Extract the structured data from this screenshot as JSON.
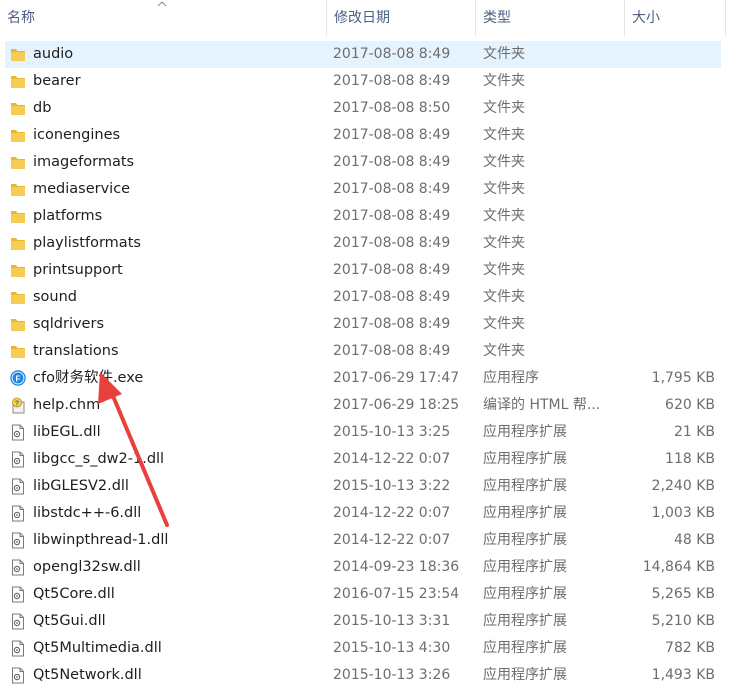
{
  "columns": {
    "name": "名称",
    "date": "修改日期",
    "type": "类型",
    "size": "大小"
  },
  "files": [
    {
      "name": "audio",
      "date": "2017-08-08 8:49",
      "type": "文件夹",
      "size": "",
      "icon": "folder-icon",
      "selected": true
    },
    {
      "name": "bearer",
      "date": "2017-08-08 8:49",
      "type": "文件夹",
      "size": "",
      "icon": "folder-icon"
    },
    {
      "name": "db",
      "date": "2017-08-08 8:50",
      "type": "文件夹",
      "size": "",
      "icon": "folder-icon"
    },
    {
      "name": "iconengines",
      "date": "2017-08-08 8:49",
      "type": "文件夹",
      "size": "",
      "icon": "folder-icon"
    },
    {
      "name": "imageformats",
      "date": "2017-08-08 8:49",
      "type": "文件夹",
      "size": "",
      "icon": "folder-icon"
    },
    {
      "name": "mediaservice",
      "date": "2017-08-08 8:49",
      "type": "文件夹",
      "size": "",
      "icon": "folder-icon"
    },
    {
      "name": "platforms",
      "date": "2017-08-08 8:49",
      "type": "文件夹",
      "size": "",
      "icon": "folder-icon"
    },
    {
      "name": "playlistformats",
      "date": "2017-08-08 8:49",
      "type": "文件夹",
      "size": "",
      "icon": "folder-icon"
    },
    {
      "name": "printsupport",
      "date": "2017-08-08 8:49",
      "type": "文件夹",
      "size": "",
      "icon": "folder-icon"
    },
    {
      "name": "sound",
      "date": "2017-08-08 8:49",
      "type": "文件夹",
      "size": "",
      "icon": "folder-icon"
    },
    {
      "name": "sqldrivers",
      "date": "2017-08-08 8:49",
      "type": "文件夹",
      "size": "",
      "icon": "folder-icon"
    },
    {
      "name": "translations",
      "date": "2017-08-08 8:49",
      "type": "文件夹",
      "size": "",
      "icon": "folder-icon"
    },
    {
      "name": "cfo财务软件.exe",
      "date": "2017-06-29 17:47",
      "type": "应用程序",
      "size": "1,795 KB",
      "icon": "app-exe-icon"
    },
    {
      "name": "help.chm",
      "date": "2017-06-29 18:25",
      "type": "编译的 HTML 帮...",
      "size": "620 KB",
      "icon": "help-file-icon"
    },
    {
      "name": "libEGL.dll",
      "date": "2015-10-13 3:25",
      "type": "应用程序扩展",
      "size": "21 KB",
      "icon": "dll-file-icon"
    },
    {
      "name": "libgcc_s_dw2-1.dll",
      "date": "2014-12-22 0:07",
      "type": "应用程序扩展",
      "size": "118 KB",
      "icon": "dll-file-icon"
    },
    {
      "name": "libGLESV2.dll",
      "date": "2015-10-13 3:22",
      "type": "应用程序扩展",
      "size": "2,240 KB",
      "icon": "dll-file-icon"
    },
    {
      "name": "libstdc++-6.dll",
      "date": "2014-12-22 0:07",
      "type": "应用程序扩展",
      "size": "1,003 KB",
      "icon": "dll-file-icon"
    },
    {
      "name": "libwinpthread-1.dll",
      "date": "2014-12-22 0:07",
      "type": "应用程序扩展",
      "size": "48 KB",
      "icon": "dll-file-icon"
    },
    {
      "name": "opengl32sw.dll",
      "date": "2014-09-23 18:36",
      "type": "应用程序扩展",
      "size": "14,864 KB",
      "icon": "dll-file-icon"
    },
    {
      "name": "Qt5Core.dll",
      "date": "2016-07-15 23:54",
      "type": "应用程序扩展",
      "size": "5,265 KB",
      "icon": "dll-file-icon"
    },
    {
      "name": "Qt5Gui.dll",
      "date": "2015-10-13 3:31",
      "type": "应用程序扩展",
      "size": "5,210 KB",
      "icon": "dll-file-icon"
    },
    {
      "name": "Qt5Multimedia.dll",
      "date": "2015-10-13 4:30",
      "type": "应用程序扩展",
      "size": "782 KB",
      "icon": "dll-file-icon"
    },
    {
      "name": "Qt5Network.dll",
      "date": "2015-10-13 3:26",
      "type": "应用程序扩展",
      "size": "1,493 KB",
      "icon": "dll-file-icon"
    }
  ],
  "colors": {
    "header_text": "#4d6082",
    "selection": "#e5f3ff",
    "folder": "#e8b832",
    "annotation_arrow": "#e8413c"
  }
}
